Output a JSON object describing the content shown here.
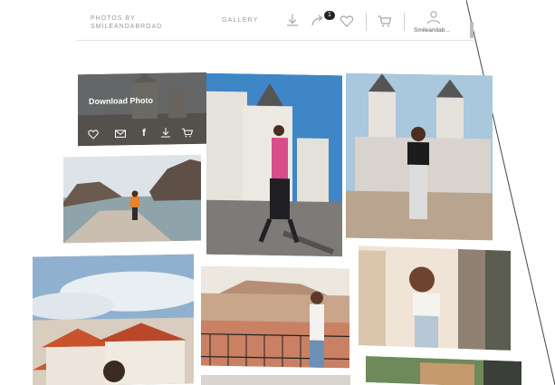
{
  "header": {
    "brand_line1": "PHOTOS BY",
    "brand_line2": "SMILEANDABROAD",
    "nav_gallery": "GALLERY",
    "cart_count": "1",
    "username": "Smileandab..."
  },
  "icons": {
    "download": "download-icon",
    "share": "share-icon",
    "favorite": "heart-icon",
    "cart": "cart-icon",
    "user": "user-icon"
  },
  "hover_overlay": {
    "title": "Download Photo",
    "actions": [
      "heart-icon",
      "mail-icon",
      "facebook-icon",
      "download-icon",
      "cart-icon"
    ],
    "facebook_glyph": "f"
  },
  "photos": [
    "madrid-cathedral-dark",
    "madrid-street-pink-jacket",
    "madrid-cathedral-crop-top",
    "coastal-rocks-orange-top",
    "red-roof-village",
    "athens-acropolis-balcony",
    "athens-column-white-top",
    "bottom-partial-left",
    "bottom-partial-center",
    "bottom-partial-right"
  ],
  "colors": {
    "header_text": "#9a9a9a",
    "badge": "#222222",
    "overlay": "rgba(20,20,20,0.55)"
  }
}
